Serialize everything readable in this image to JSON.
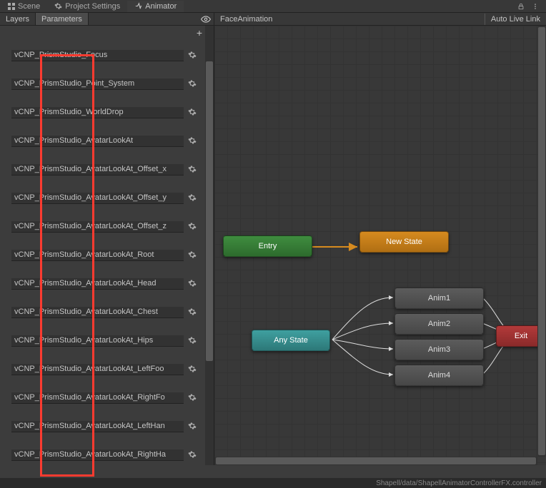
{
  "tabs": {
    "scene": "Scene",
    "project_settings": "Project Settings",
    "animator": "Animator"
  },
  "sub_tabs": {
    "layers": "Layers",
    "parameters": "Parameters"
  },
  "breadcrumb": "FaceAnimation",
  "auto_live_link": "Auto Live Link",
  "parameters": [
    "vCNP_PrismStudio_Focus",
    "vCNP_PrismStudio_Point_System",
    "vCNP_PrismStudio_WorldDrop",
    "vCNP_PrismStudio_AvatarLookAt",
    "vCNP_PrismStudio_AvatarLookAt_Offset_x",
    "vCNP_PrismStudio_AvatarLookAt_Offset_y",
    "vCNP_PrismStudio_AvatarLookAt_Offset_z",
    "vCNP_PrismStudio_AvatarLookAt_Root",
    "vCNP_PrismStudio_AvatarLookAt_Head",
    "vCNP_PrismStudio_AvatarLookAt_Chest",
    "vCNP_PrismStudio_AvatarLookAt_Hips",
    "vCNP_PrismStudio_AvatarLookAt_LeftFoo",
    "vCNP_PrismStudio_AvatarLookAt_RightFo",
    "vCNP_PrismStudio_AvatarLookAt_LeftHan",
    "vCNP_PrismStudio_AvatarLookAt_RightHa"
  ],
  "nodes": {
    "entry": "Entry",
    "new_state": "New State",
    "any_state": "Any State",
    "exit": "Exit",
    "anim1": "Anim1",
    "anim2": "Anim2",
    "anim3": "Anim3",
    "anim4": "Anim4"
  },
  "status_path": "Shapell/data/ShapellAnimatorControllerFX.controller"
}
